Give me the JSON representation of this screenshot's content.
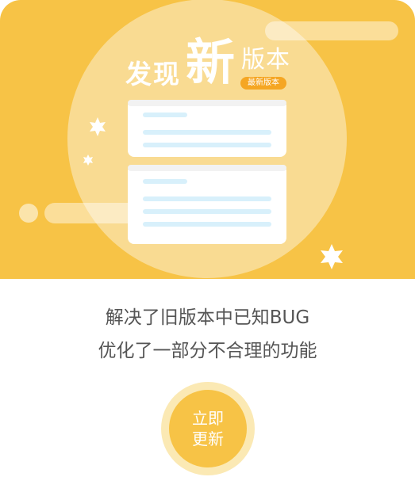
{
  "banner": {
    "title_part1": "发现",
    "title_part2": "新",
    "title_part3": "版本",
    "badge": "最新版本",
    "star_icon": "star-icon",
    "document_icon": "document-card-icon",
    "colors": {
      "background": "#f7c346",
      "card": "#ffffff",
      "card_lines": "#d8f0fb",
      "badge": "#f5a623"
    }
  },
  "message": {
    "line1": "解决了旧版本中已知BUG",
    "line2": "优化了一部分不合理的功能"
  },
  "update_button": {
    "line1": "立即",
    "line2": "更新",
    "colors": {
      "fill": "#f7c346",
      "ring": "#fbe9b4"
    }
  }
}
